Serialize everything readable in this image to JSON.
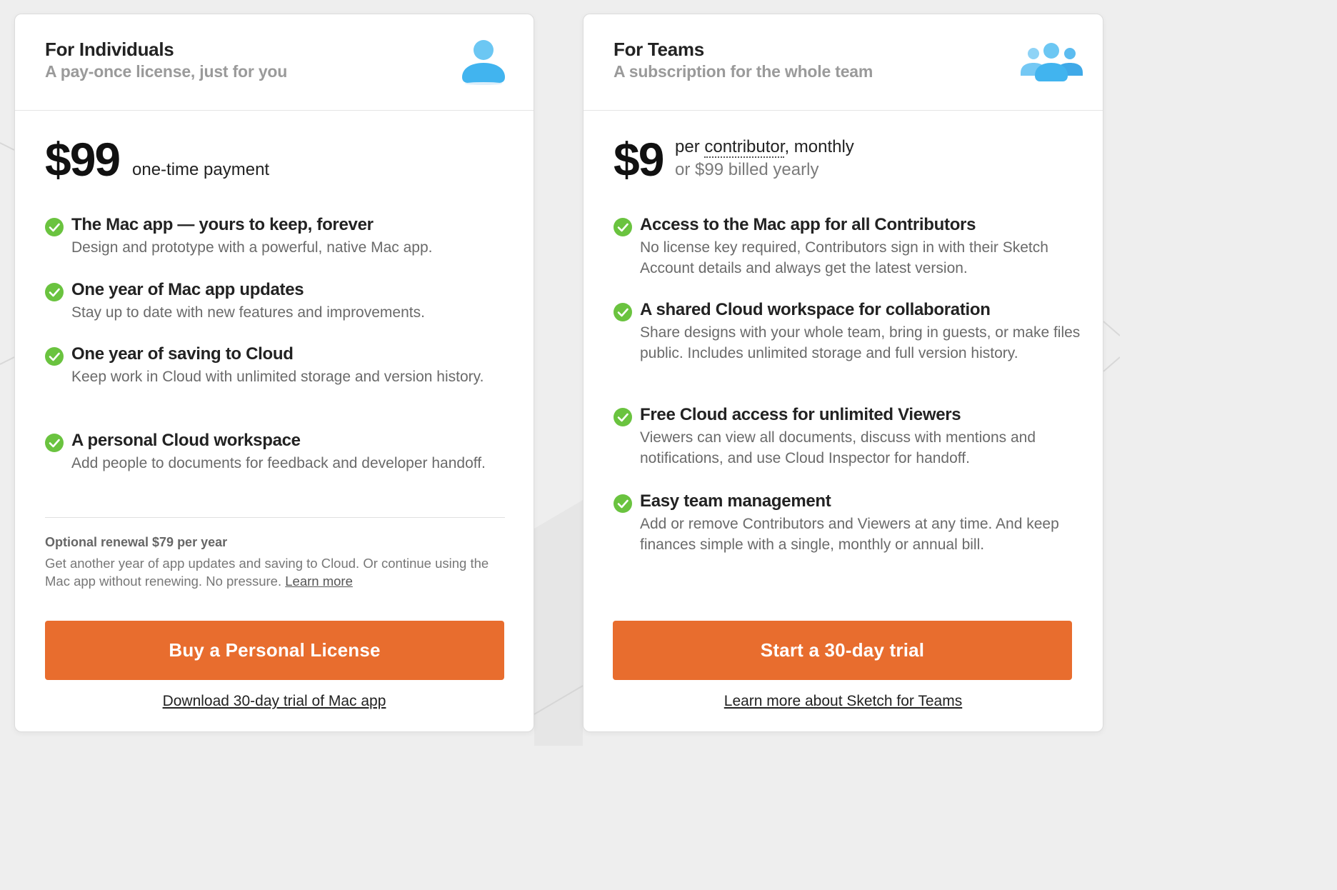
{
  "colors": {
    "accent": "#e86d2e",
    "check": "#6ac33f",
    "icon_blue": "#5cc0f2"
  },
  "individuals": {
    "title": "For Individuals",
    "subtitle": "A pay-once license, just for you",
    "icon": "person-icon",
    "price": "$99",
    "price_suffix": "one-time payment",
    "features": [
      {
        "title": "The Mac app — yours to keep, forever",
        "desc": "Design and prototype with a powerful, native Mac app."
      },
      {
        "title": "One year of Mac app updates",
        "desc": "Stay up to date with new features and improvements."
      },
      {
        "title": "One year of saving to Cloud",
        "desc": "Keep work in Cloud with unlimited storage and version history."
      },
      {
        "title": "A personal Cloud workspace",
        "desc": "Add people to documents for feedback and developer handoff."
      }
    ],
    "renewal_title": "Optional renewal $79 per year",
    "renewal_desc": "Get another year of app updates and saving to Cloud. Or continue using the Mac app without renewing. No pressure.",
    "renewal_link": "Learn more",
    "cta": "Buy a Personal License",
    "secondary_link": "Download 30-day trial of Mac app"
  },
  "teams": {
    "title": "For Teams",
    "subtitle": "A subscription for the whole team",
    "icon": "team-icon",
    "price": "$9",
    "price_per": "per",
    "price_contributor": "contributor",
    "price_monthly": ", monthly",
    "price_yearly": "or $99 billed yearly",
    "features": [
      {
        "title": "Access to the Mac app for all Contributors",
        "desc": "No license key required, Contributors sign in with their Sketch Account details and always get the latest version."
      },
      {
        "title": "A shared Cloud workspace for collaboration",
        "desc": "Share designs with your whole team, bring in guests, or make files public. Includes unlimited storage and full version history."
      },
      {
        "title": "Free Cloud access for unlimited Viewers",
        "desc": "Viewers can view all documents, discuss with mentions and notifications, and use Cloud Inspector for handoff."
      },
      {
        "title": "Easy team management",
        "desc": "Add or remove Contributors and Viewers at any time. And keep finances simple with a single, monthly or annual bill."
      }
    ],
    "cta": "Start a 30-day trial",
    "secondary_link": "Learn more about Sketch for Teams"
  }
}
